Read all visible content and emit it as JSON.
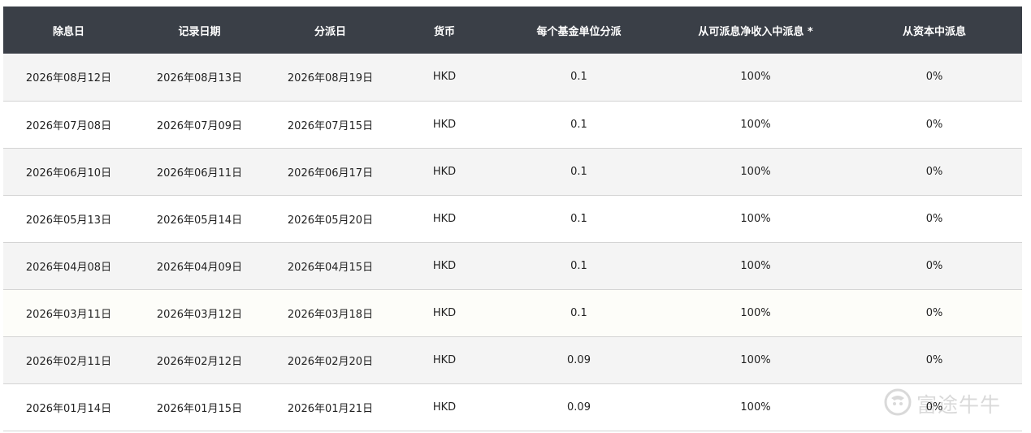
{
  "table": {
    "headers": [
      "除息日",
      "记录日期",
      "分派日",
      "货币",
      "每个基金单位分派",
      "从可派息净收入中派息 *",
      "从资本中派息"
    ],
    "rows": [
      [
        "2026年08月12日",
        "2026年08月13日",
        "2026年08月19日",
        "HKD",
        "0.1",
        "100%",
        "0%"
      ],
      [
        "2026年07月08日",
        "2026年07月09日",
        "2026年07月15日",
        "HKD",
        "0.1",
        "100%",
        "0%"
      ],
      [
        "2026年06月10日",
        "2026年06月11日",
        "2026年06月17日",
        "HKD",
        "0.1",
        "100%",
        "0%"
      ],
      [
        "2026年05月13日",
        "2026年05月14日",
        "2026年05月20日",
        "HKD",
        "0.1",
        "100%",
        "0%"
      ],
      [
        "2026年04月08日",
        "2026年04月09日",
        "2026年04月15日",
        "HKD",
        "0.1",
        "100%",
        "0%"
      ],
      [
        "2026年03月11日",
        "2026年03月12日",
        "2026年03月18日",
        "HKD",
        "0.1",
        "100%",
        "0%"
      ],
      [
        "2026年02月11日",
        "2026年02月12日",
        "2026年02月20日",
        "HKD",
        "0.09",
        "100%",
        "0%"
      ],
      [
        "2026年01月14日",
        "2026年01月15日",
        "2026年01月21日",
        "HKD",
        "0.09",
        "100%",
        "0%"
      ]
    ]
  },
  "watermark": {
    "text": "富途牛牛",
    "icon": "futu-logo-icon"
  },
  "colors": {
    "header_bg": "#3a3f47",
    "header_text": "#ffffff",
    "row_alt_bg": "#f4f4f4"
  }
}
